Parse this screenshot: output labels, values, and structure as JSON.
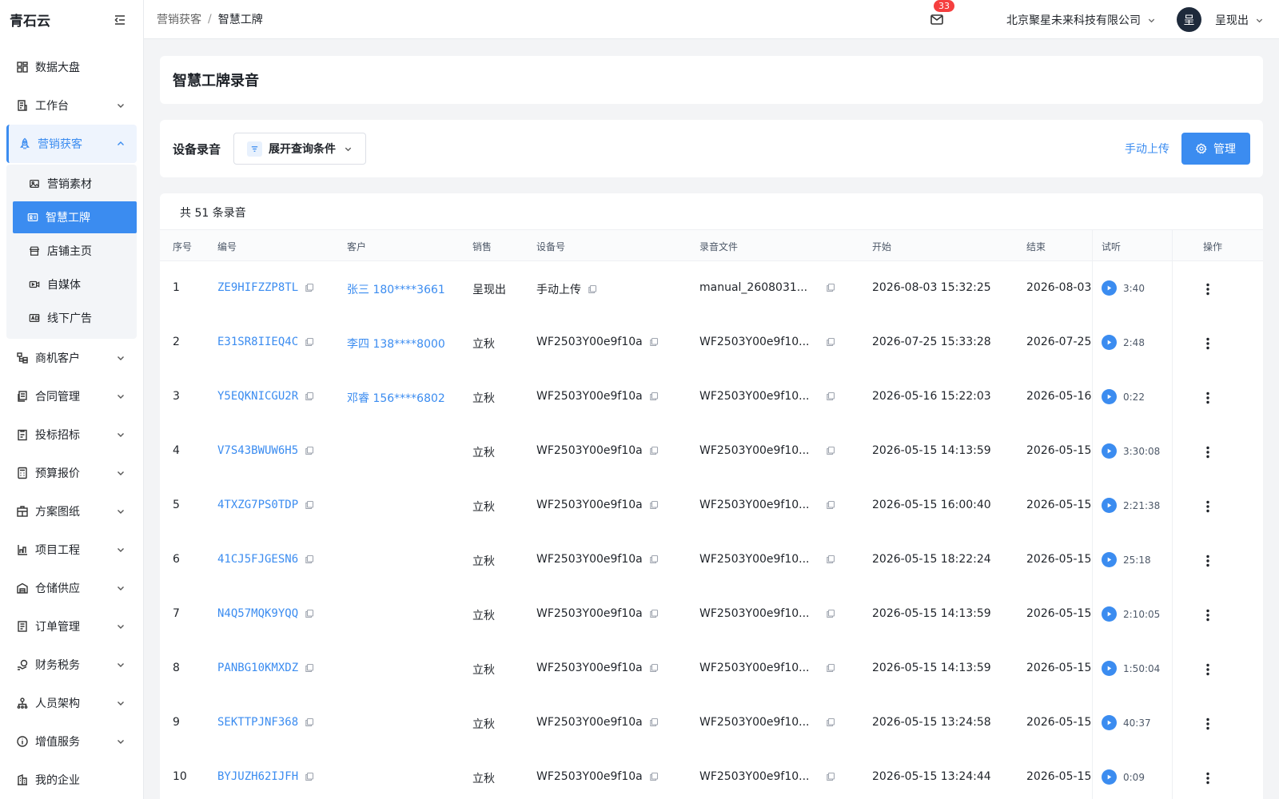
{
  "sidebar": {
    "brand": "青石云",
    "items": [
      {
        "label": "数据大盘",
        "icon": "dashboard-icon",
        "expandable": false
      },
      {
        "label": "工作台",
        "icon": "workbench-icon",
        "expandable": true
      },
      {
        "label": "营销获客",
        "icon": "rocket-icon",
        "expandable": true,
        "expanded": true
      },
      {
        "label": "商机客户",
        "icon": "customers-icon",
        "expandable": true
      },
      {
        "label": "合同管理",
        "icon": "contract-icon",
        "expandable": true
      },
      {
        "label": "投标招标",
        "icon": "bid-icon",
        "expandable": true
      },
      {
        "label": "预算报价",
        "icon": "calculator-icon",
        "expandable": true
      },
      {
        "label": "方案图纸",
        "icon": "blueprint-icon",
        "expandable": true
      },
      {
        "label": "项目工程",
        "icon": "project-icon",
        "expandable": true
      },
      {
        "label": "仓储供应",
        "icon": "warehouse-icon",
        "expandable": true
      },
      {
        "label": "订单管理",
        "icon": "order-icon",
        "expandable": true
      },
      {
        "label": "财务税务",
        "icon": "finance-icon",
        "expandable": true
      },
      {
        "label": "人员架构",
        "icon": "org-icon",
        "expandable": true
      },
      {
        "label": "增值服务",
        "icon": "info-icon",
        "expandable": true
      },
      {
        "label": "我的企业",
        "icon": "enterprise-icon",
        "expandable": false
      }
    ],
    "sub_items": [
      {
        "label": "营销素材",
        "icon": "image-icon"
      },
      {
        "label": "智慧工牌",
        "icon": "badge-card-icon",
        "active": true
      },
      {
        "label": "店铺主页",
        "icon": "store-icon"
      },
      {
        "label": "自媒体",
        "icon": "video-icon"
      },
      {
        "label": "线下广告",
        "icon": "ad-icon"
      }
    ]
  },
  "header": {
    "breadcrumb": [
      "营销获客",
      "智慧工牌"
    ],
    "breadcrumb_sep": "/",
    "mail_count": "33",
    "company": "北京聚星未来科技有限公司",
    "avatar_text": "呈",
    "user_name": "呈现出"
  },
  "page": {
    "title": "智慧工牌录音",
    "section_label": "设备录音",
    "expand_label": "展开查询条件",
    "upload_label": "手动上传",
    "manage_label": "管理",
    "count_text": "共 51 条录音"
  },
  "table": {
    "columns": [
      "序号",
      "编号",
      "客户",
      "销售",
      "设备号",
      "录音文件",
      "开始",
      "结束",
      "试听",
      "操作"
    ],
    "rows": [
      {
        "no": "1",
        "code": "ZE9HIFZZP8TL",
        "customer": "张三 180****3661",
        "sales": "呈现出",
        "device": "手动上传",
        "file": "manual_2608031...",
        "start": "2026-08-03 15:32:25",
        "end": "2026-08-03",
        "duration": "3:40"
      },
      {
        "no": "2",
        "code": "E31SR8IIEQ4C",
        "customer": "李四 138****8000",
        "sales": "立秋",
        "device": "WF2503Y00e9f10a",
        "file": "WF2503Y00e9f10...",
        "start": "2026-07-25 15:33:28",
        "end": "2026-07-25",
        "duration": "2:48"
      },
      {
        "no": "3",
        "code": "Y5EQKNICGU2R",
        "customer": "邓睿 156****6802",
        "sales": "立秋",
        "device": "WF2503Y00e9f10a",
        "file": "WF2503Y00e9f10...",
        "start": "2026-05-16 15:22:03",
        "end": "2026-05-16",
        "duration": "0:22"
      },
      {
        "no": "4",
        "code": "V7S43BWUW6H5",
        "customer": "",
        "sales": "立秋",
        "device": "WF2503Y00e9f10a",
        "file": "WF2503Y00e9f10...",
        "start": "2026-05-15 14:13:59",
        "end": "2026-05-15",
        "duration": "3:30:08"
      },
      {
        "no": "5",
        "code": "4TXZG7PS0TDP",
        "customer": "",
        "sales": "立秋",
        "device": "WF2503Y00e9f10a",
        "file": "WF2503Y00e9f10...",
        "start": "2026-05-15 16:00:40",
        "end": "2026-05-15",
        "duration": "2:21:38"
      },
      {
        "no": "6",
        "code": "41CJ5FJGESN6",
        "customer": "",
        "sales": "立秋",
        "device": "WF2503Y00e9f10a",
        "file": "WF2503Y00e9f10...",
        "start": "2026-05-15 18:22:24",
        "end": "2026-05-15",
        "duration": "25:18"
      },
      {
        "no": "7",
        "code": "N4Q57MQK9YQQ",
        "customer": "",
        "sales": "立秋",
        "device": "WF2503Y00e9f10a",
        "file": "WF2503Y00e9f10...",
        "start": "2026-05-15 14:13:59",
        "end": "2026-05-15",
        "duration": "2:10:05"
      },
      {
        "no": "8",
        "code": "PANBG10KMXDZ",
        "customer": "",
        "sales": "立秋",
        "device": "WF2503Y00e9f10a",
        "file": "WF2503Y00e9f10...",
        "start": "2026-05-15 14:13:59",
        "end": "2026-05-15",
        "duration": "1:50:04"
      },
      {
        "no": "9",
        "code": "SEKTTPJNF368",
        "customer": "",
        "sales": "立秋",
        "device": "WF2503Y00e9f10a",
        "file": "WF2503Y00e9f10...",
        "start": "2026-05-15 13:24:58",
        "end": "2026-05-15",
        "duration": "40:37"
      },
      {
        "no": "10",
        "code": "BYJUZH62IJFH",
        "customer": "",
        "sales": "立秋",
        "device": "WF2503Y00e9f10a",
        "file": "WF2503Y00e9f10...",
        "start": "2026-05-15 13:24:44",
        "end": "2026-05-15",
        "duration": "0:09"
      }
    ]
  },
  "colors": {
    "accent": "#3b8cf0",
    "badge": "#f53f3f",
    "avatar": "#1e2a3b"
  }
}
